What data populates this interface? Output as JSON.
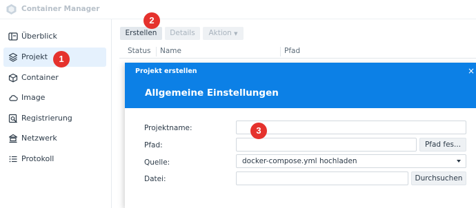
{
  "app": {
    "title": "Container Manager"
  },
  "sidebar": {
    "items": [
      {
        "label": "Überblick",
        "icon": "overview-icon",
        "active": false
      },
      {
        "label": "Projekt",
        "icon": "layers-icon",
        "active": true
      },
      {
        "label": "Container",
        "icon": "cube-icon",
        "active": false
      },
      {
        "label": "Image",
        "icon": "cloud-icon",
        "active": false
      },
      {
        "label": "Registrierung",
        "icon": "registry-search-icon",
        "active": false
      },
      {
        "label": "Netzwerk",
        "icon": "network-icon",
        "active": false
      },
      {
        "label": "Protokoll",
        "icon": "log-list-icon",
        "active": false
      }
    ]
  },
  "toolbar": {
    "create_label": "Erstellen",
    "details_label": "Details",
    "action_label": "Aktion"
  },
  "table": {
    "columns": [
      "Status",
      "Name",
      "Pfad"
    ]
  },
  "dialog": {
    "title": "Projekt erstellen",
    "close": "×",
    "heading": "Allgemeine Einstellungen",
    "fields": {
      "projektname": {
        "label": "Projektname:",
        "value": ""
      },
      "pfad": {
        "label": "Pfad:",
        "value": "",
        "button": "Pfad fes..."
      },
      "quelle": {
        "label": "Quelle:",
        "value": "docker-compose.yml hochladen"
      },
      "datei": {
        "label": "Datei:",
        "value": "",
        "button": "Durchsuchen"
      }
    }
  },
  "annotations": [
    "1",
    "2",
    "3"
  ],
  "colors": {
    "accent": "#0c80e6",
    "marker": "#e5322d",
    "active_bg": "#e5f1fd"
  }
}
